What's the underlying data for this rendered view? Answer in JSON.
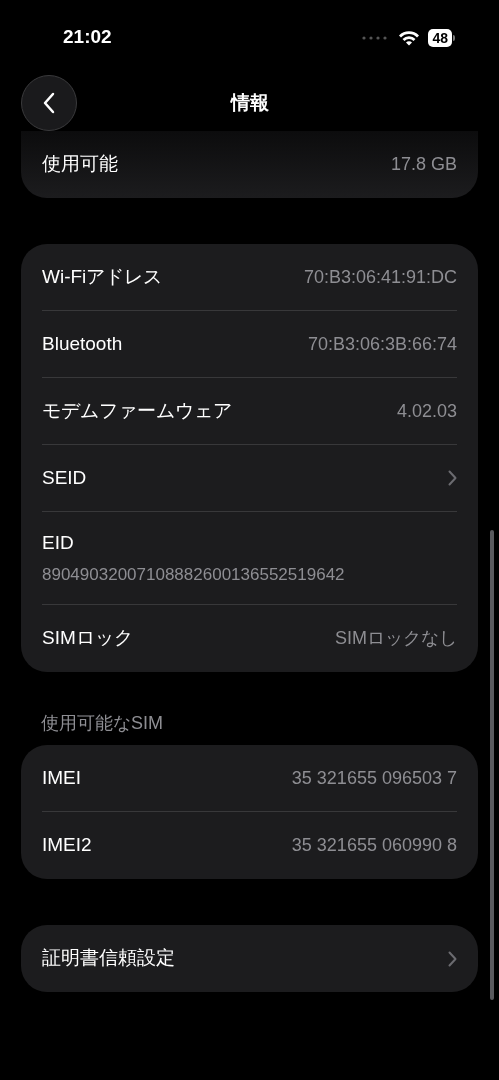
{
  "status_bar": {
    "time": "21:02",
    "battery": "48"
  },
  "nav": {
    "title": "情報"
  },
  "sections": [
    {
      "rows": [
        {
          "kind": "value",
          "label": "使用可能",
          "value": "17.8 GB"
        }
      ]
    },
    {
      "rows": [
        {
          "kind": "value",
          "label": "Wi-Fiアドレス",
          "value": "70:B3:06:41:91:DC"
        },
        {
          "kind": "value",
          "label": "Bluetooth",
          "value": "70:B3:06:3B:66:74"
        },
        {
          "kind": "value",
          "label": "モデムファームウェア",
          "value": "4.02.03"
        },
        {
          "kind": "chevron",
          "label": "SEID"
        },
        {
          "kind": "stacked",
          "label": "EID",
          "value": "89049032007108882600136552519642"
        },
        {
          "kind": "value",
          "label": "SIMロック",
          "value": "SIMロックなし"
        }
      ]
    },
    {
      "header": "使用可能なSIM",
      "rows": [
        {
          "kind": "value",
          "label": "IMEI",
          "value": "35 321655 096503 7"
        },
        {
          "kind": "value",
          "label": "IMEI2",
          "value": "35 321655 060990 8"
        }
      ]
    },
    {
      "rows": [
        {
          "kind": "chevron",
          "label": "証明書信頼設定"
        }
      ]
    }
  ]
}
